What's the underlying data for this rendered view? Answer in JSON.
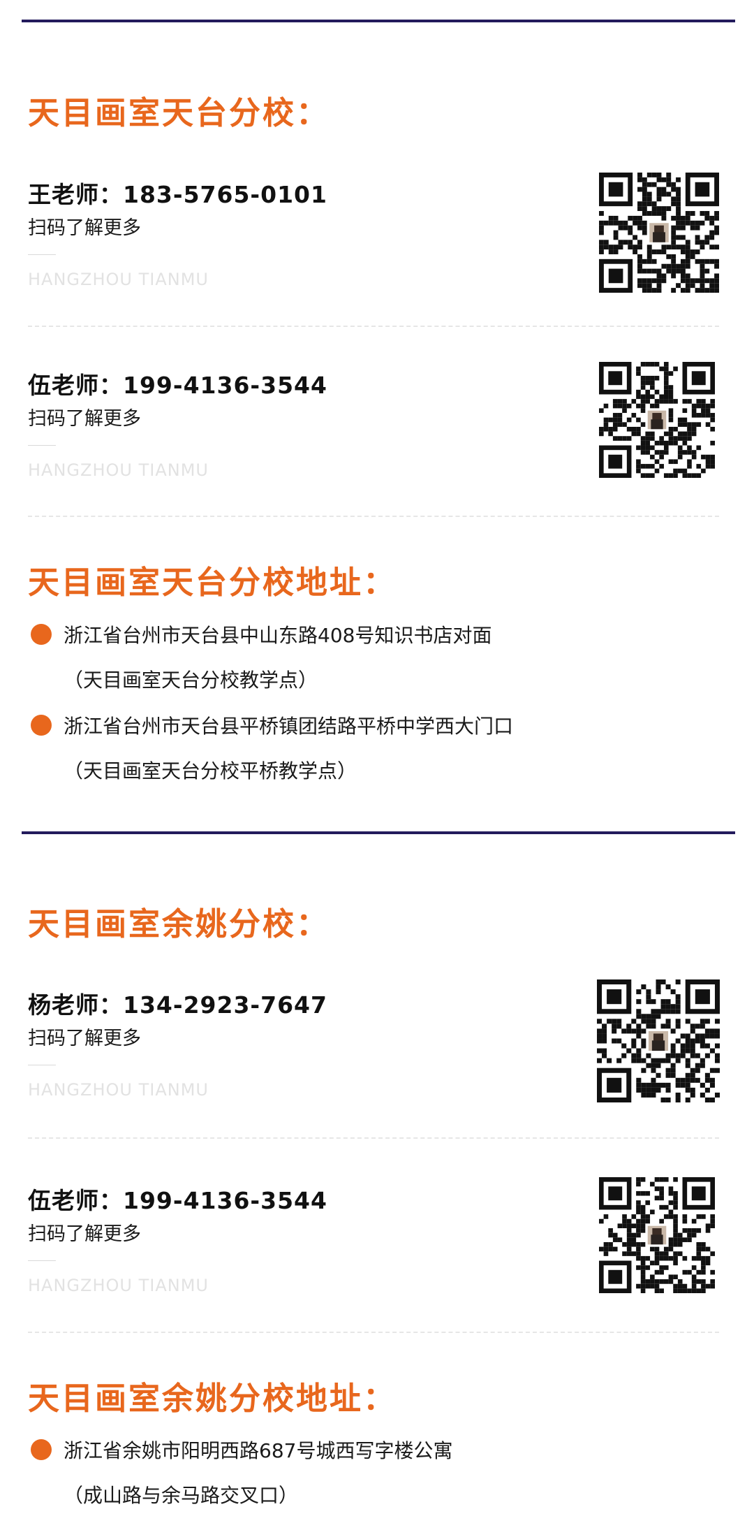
{
  "sections": [
    {
      "title": "天目画室天台分校：",
      "contacts": [
        {
          "name": "王老师：183-5765-0101",
          "sub": "扫码了解更多",
          "en": "HANGZHOU TIANMU",
          "qr_icon": "qr-code-icon"
        },
        {
          "name": "伍老师：199-4136-3544",
          "sub": "扫码了解更多",
          "en": "HANGZHOU TIANMU",
          "qr_icon": "qr-code-icon"
        }
      ],
      "address_title": "天目画室天台分校地址：",
      "addresses": [
        {
          "line1": "浙江省台州市天台县中山东路408号知识书店对面",
          "line2": "（天目画室天台分校教学点）"
        },
        {
          "line1": "浙江省台州市天台县平桥镇团结路平桥中学西大门口",
          "line2": "（天目画室天台分校平桥教学点）"
        }
      ]
    },
    {
      "title": "天目画室余姚分校：",
      "contacts": [
        {
          "name": "杨老师：134-2923-7647",
          "sub": "扫码了解更多",
          "en": "HANGZHOU TIANMU",
          "qr_icon": "qr-code-icon"
        },
        {
          "name": "伍老师：199-4136-3544",
          "sub": "扫码了解更多",
          "en": "HANGZHOU TIANMU",
          "qr_icon": "qr-code-icon"
        }
      ],
      "address_title": "天目画室余姚分校地址：",
      "addresses": [
        {
          "line1": "浙江省余姚市阳明西路687号城西写字楼公寓",
          "line2": "（成山路与余马路交叉口）"
        }
      ]
    }
  ],
  "colors": {
    "accent": "#e8671d",
    "rule": "#231b5c",
    "muted": "#e2e2e2"
  }
}
